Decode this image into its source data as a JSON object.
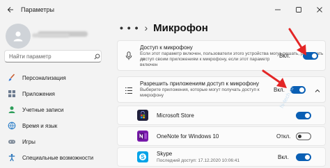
{
  "window": {
    "title": "Параметры"
  },
  "sidebar": {
    "search_placeholder": "Найти параметр",
    "items": [
      {
        "label": "Персонализация",
        "icon": "brush-icon"
      },
      {
        "label": "Приложения",
        "icon": "apps-icon"
      },
      {
        "label": "Учетные записи",
        "icon": "user-icon"
      },
      {
        "label": "Время и язык",
        "icon": "globe-clock-icon"
      },
      {
        "label": "Игры",
        "icon": "gamepad-icon"
      },
      {
        "label": "Специальные возможности",
        "icon": "accessibility-icon"
      }
    ]
  },
  "breadcrumb": {
    "ellipsis": "• • •",
    "separator": "›",
    "title": "Микрофон"
  },
  "mic_access": {
    "title": "Доступ к микрофону",
    "description_line1": "Если этот параметр включен, пользователи этого устройства могут решать, разрешать ли",
    "description_line2": "доступ своим приложениям к микрофону, если этот параметр",
    "description_line3": "включен",
    "state": "Вкл.",
    "on": true
  },
  "apps_access": {
    "title": "Разрешить приложениям доступ к микрофону",
    "description_line1": "Выберите приложения, которые могут получать доступ к",
    "description_line2": "микрофону",
    "state": "Вкл.",
    "on": true
  },
  "apps": [
    {
      "name": "Microsoft Store",
      "subtitle": "",
      "state": "",
      "on": true,
      "color": "#1f1f3a"
    },
    {
      "name": "OneNote for Windows 10",
      "subtitle": "",
      "state": "Откл.",
      "on": false,
      "color": "#7719aa"
    },
    {
      "name": "Skype",
      "subtitle": "Последний доступ: 17.12.2020 10:06:41",
      "state": "Вкл.",
      "on": true,
      "color": "#00a3e8"
    }
  ],
  "watermark": "hi-tech.ru",
  "colors": {
    "accent": "#0a5fb4",
    "arrow": "#e32626"
  }
}
